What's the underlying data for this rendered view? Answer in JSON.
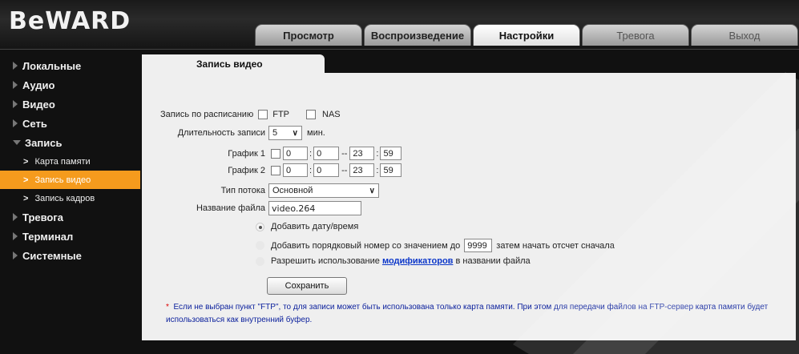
{
  "brand": {
    "logo": "BeWARD"
  },
  "nav_tabs": [
    "Просмотр",
    "Воспроизведение",
    "Настройки",
    "Тревога",
    "Выход"
  ],
  "sidebar": {
    "items": [
      {
        "label": "Локальные"
      },
      {
        "label": "Аудио"
      },
      {
        "label": "Видео"
      },
      {
        "label": "Сеть"
      },
      {
        "label": "Запись"
      }
    ],
    "sub_items": [
      {
        "label": "Карта памяти"
      },
      {
        "label": "Запись видео"
      },
      {
        "label": "Запись кадров"
      }
    ],
    "items_after": [
      {
        "label": "Тревога"
      },
      {
        "label": "Терминал"
      },
      {
        "label": "Системные"
      }
    ]
  },
  "panel": {
    "tab_title": "Запись видео",
    "schedule_label": "Запись по расписанию",
    "ftp_label": "FTP",
    "nas_label": "NAS",
    "duration_label": "Длительность записи",
    "duration_value": "5",
    "duration_unit": "мин.",
    "graph1_label": "График 1",
    "graph2_label": "График 2",
    "graph1": [
      "0",
      "0",
      "23",
      "59"
    ],
    "graph2": [
      "0",
      "0",
      "23",
      "59"
    ],
    "stream_label": "Тип потока",
    "stream_value": "Основной",
    "filename_label": "Название файла",
    "filename_value": "video.264",
    "opt_datetime": "Добавить дату/время",
    "opt_seq_before": "Добавить порядковый номер со значением до",
    "opt_seq_value": "9999",
    "opt_seq_after": "затем начать отсчет сначала",
    "opt_mod_before": "Разрешить использование",
    "opt_mod_link": "модификаторов",
    "opt_mod_after": "в названии файла",
    "save_label": "Сохранить",
    "note_star": "*",
    "note_text": "Если не выбран пункт \"FTP\", то для записи может быть использована только карта памяти. При этом для передачи файлов на FTP-сервер карта памяти будет использоваться как внутренний буфер."
  },
  "colors": {
    "accent": "#f59b1d",
    "link": "#0b36c9"
  }
}
